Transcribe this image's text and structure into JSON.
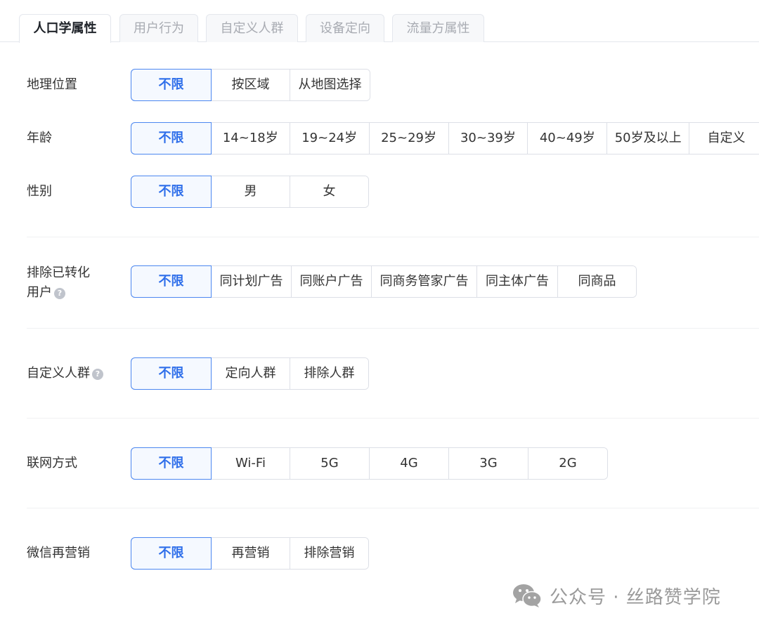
{
  "tabs": [
    {
      "label": "人口学属性",
      "active": true
    },
    {
      "label": "用户行为",
      "active": false
    },
    {
      "label": "自定义人群",
      "active": false
    },
    {
      "label": "设备定向",
      "active": false
    },
    {
      "label": "流量方属性",
      "active": false
    }
  ],
  "rows": {
    "geo": {
      "label": "地理位置",
      "options": [
        "不限",
        "按区域",
        "从地图选择"
      ]
    },
    "age": {
      "label": "年龄",
      "options": [
        "不限",
        "14~18岁",
        "19~24岁",
        "25~29岁",
        "30~39岁",
        "40~49岁",
        "50岁及以上",
        "自定义"
      ]
    },
    "gender": {
      "label": "性别",
      "options": [
        "不限",
        "男",
        "女"
      ]
    },
    "exclude_converted": {
      "label_line1": "排除已转化",
      "label_line2": "用户",
      "help": "?",
      "options": [
        "不限",
        "同计划广告",
        "同账户广告",
        "同商务管家广告",
        "同主体广告",
        "同商品"
      ]
    },
    "custom_audience": {
      "label": "自定义人群",
      "help": "?",
      "options": [
        "不限",
        "定向人群",
        "排除人群"
      ]
    },
    "network": {
      "label": "联网方式",
      "options": [
        "不限",
        "Wi-Fi",
        "5G",
        "4G",
        "3G",
        "2G"
      ]
    },
    "wechat_remarketing": {
      "label": "微信再营销",
      "options": [
        "不限",
        "再营销",
        "排除营销"
      ]
    }
  },
  "selected_option": "不限",
  "accent_color": "#2f6fea",
  "watermark": {
    "icon": "wechat-icon",
    "text": "公众号 · 丝路赞学院"
  }
}
